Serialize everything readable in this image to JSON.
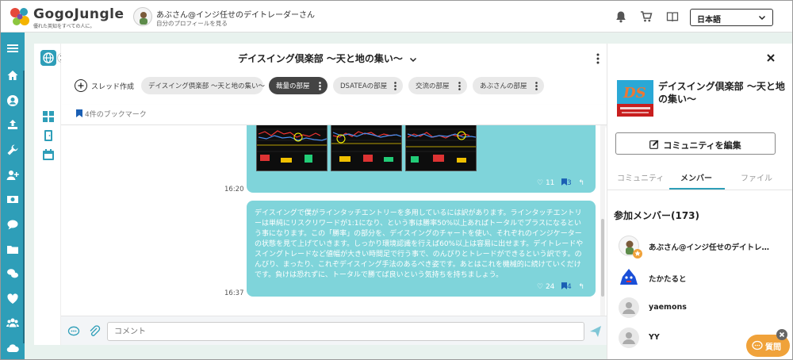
{
  "header": {
    "logo_text": "GogoJungle",
    "logo_tagline": "優れた英知をすべての人に。",
    "profile_name": "あぶさん@インジ任せのデイトレーダーさん",
    "profile_link": "自分のプロフィールを見る",
    "language": "日本語",
    "icons": [
      "bell-icon",
      "cart-icon",
      "book-icon",
      "chevron-down-icon"
    ]
  },
  "leftnav": {
    "icons": [
      "menu-icon",
      "home-icon",
      "user-icon",
      "upload-icon",
      "wrench-icon",
      "add-user-icon",
      "money-icon",
      "chat-icon",
      "folder-icon",
      "comments-icon",
      "heart-icon",
      "group-icon",
      "cloud-icon"
    ],
    "accent": "#2e9eb8"
  },
  "chat": {
    "title": "デイスイング倶楽部 〜天と地の集い〜",
    "thread_create": "スレッド作成",
    "tabs": [
      {
        "label": "デイスイング倶楽部 〜天と地の集い〜",
        "active": false
      },
      {
        "label": "裁量の部屋",
        "active": true
      },
      {
        "label": "DSATEAの部屋",
        "active": false
      },
      {
        "label": "交流の部屋",
        "active": false
      },
      {
        "label": "あぶさんの部屋",
        "active": false
      }
    ],
    "bookmarks": "4件のブックマーク",
    "messages": [
      {
        "time": "16:20",
        "likes": "11",
        "bookmarks": "3",
        "has_images": true
      },
      {
        "time": "16:37",
        "text": "デイスイングで僕がラインタッチエントリーを多用しているには訳があります。ラインタッチエントリーは単純にリスクリワードが1:1になり、という事は勝率50%以上あればトータルでプラスになるという事になります。この「勝率」の部分を、デイスイングのチャートを使い、それぞれのインジケーターの状態を見て上げていきます。しっかり環境認識を行えば60%以上は容易に出せます。デイトレードやスイングトレードなど値幅が大きい時間足で行う事で、のんびりとトレードができるという訳です。のんびり、まったり、これぞデイスイング手法のあるべき姿です。あとはこれを機械的に続けていくだけです。負けは恐れずに、トータルで勝てば良いという気持ちを持ちましょう。",
        "likes": "24",
        "bookmarks": "4"
      }
    ],
    "comment_placeholder": "コメント",
    "bubble_color": "#7fd4da"
  },
  "right_panel": {
    "community_title": "デイスイング倶楽部 〜天と地の集い〜",
    "edit_label": "コミュニティを編集",
    "tabs": [
      "コミュニティ",
      "メンバー",
      "ファイル"
    ],
    "active_tab": "メンバー",
    "members_heading": "参加メンバー(173)",
    "members": [
      {
        "name": "あぶさん@インジ任せのデイトレ…"
      },
      {
        "name": "たかたると"
      },
      {
        "name": "yaemons"
      },
      {
        "name": "YY"
      }
    ]
  },
  "help": {
    "label": "質問",
    "color": "#f0a23a"
  }
}
